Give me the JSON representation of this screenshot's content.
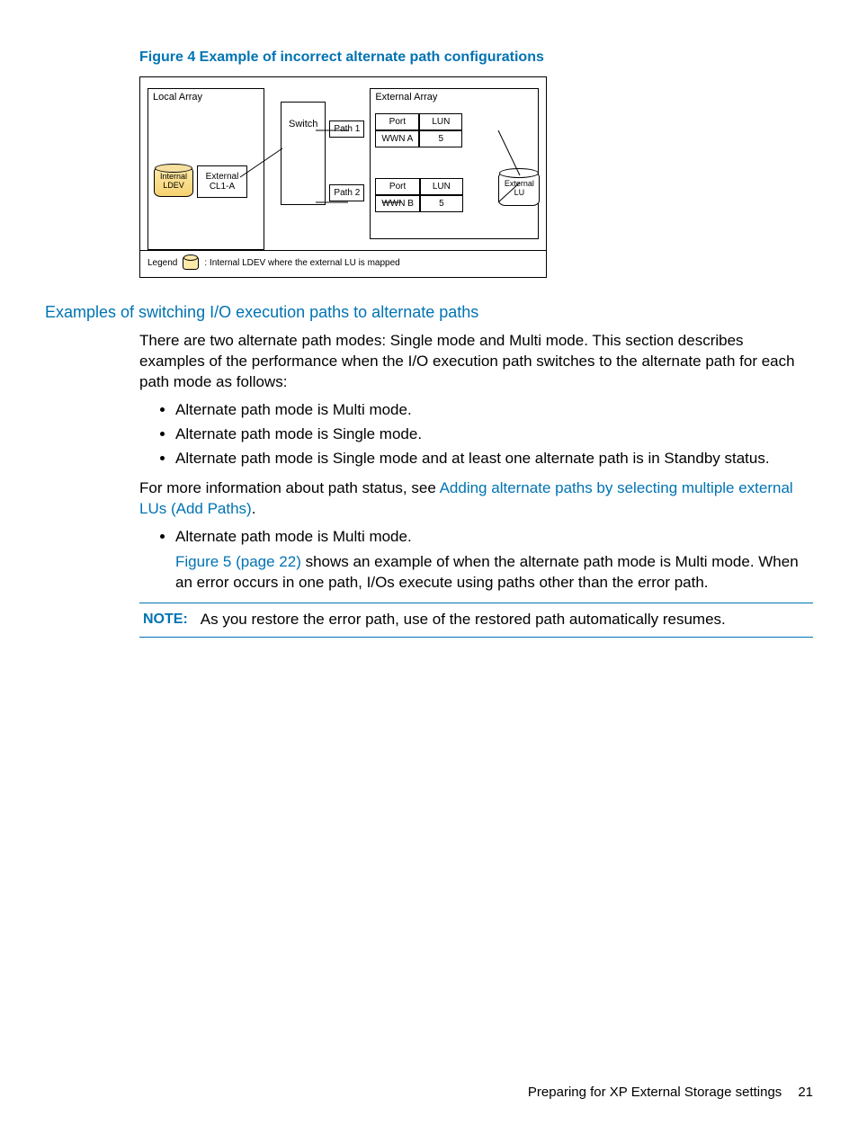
{
  "figure": {
    "caption": "Figure 4 Example of incorrect alternate path configurations",
    "localArrayTitle": "Local Array",
    "internalLDEV": "Internal\nLDEV",
    "externalPort": "External\nCL1-A",
    "switch": "Switch",
    "path1": "Path 1",
    "path2": "Path 2",
    "externalArrayTitle": "External Array",
    "portHdr": "Port",
    "lunHdr": "LUN",
    "wwnA": "WWN A",
    "lun5a": "5",
    "wwnB": "WWN B",
    "lun5b": "5",
    "externalLU": "External\nLU",
    "legendTitle": "Legend",
    "legendText": ": Internal LDEV where the external LU is mapped"
  },
  "h2": "Examples of switching I/O execution paths to alternate paths",
  "intro": "There are two alternate path modes: Single mode and Multi mode. This section describes examples of the performance when the I/O execution path switches to the alternate path for each path mode as follows:",
  "bullets": [
    "Alternate path mode is Multi mode.",
    "Alternate path mode is Single mode.",
    "Alternate path mode is Single mode and at least one alternate path is in Standby status."
  ],
  "moreinfoPre": "For more information about path status, see ",
  "moreinfoLink": "Adding alternate paths by selecting multiple external LUs (Add Paths)",
  "moreinfoPost": ".",
  "bullet2": "Alternate path mode is Multi mode.",
  "fig5link": "Figure 5 (page 22)",
  "fig5rest": " shows an example of when the alternate path mode is Multi mode. When an error occurs in one path, I/Os execute using paths other than the error path.",
  "noteLabel": "NOTE:",
  "noteText": "As you restore the error path, use of the restored path automatically resumes.",
  "footerText": "Preparing for XP External Storage settings",
  "pageNum": "21"
}
